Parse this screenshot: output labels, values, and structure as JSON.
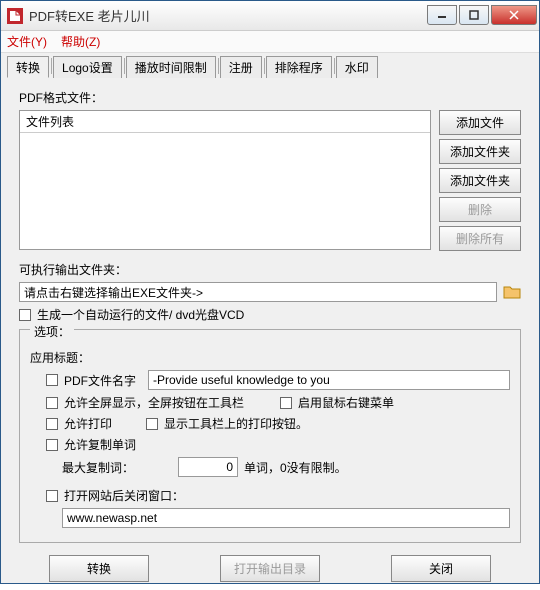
{
  "titlebar": {
    "text": "PDF转EXE   老片儿川"
  },
  "menu": {
    "file": "文件(Y)",
    "help": "帮助(Z)"
  },
  "tabs": [
    "转换",
    "Logo设置",
    "播放时间限制",
    "注册",
    "排除程序",
    "水印"
  ],
  "labels": {
    "pdfFiles": "PDF格式文件：",
    "fileListHeader": "文件列表",
    "outputFolder": "可执行输出文件夹：",
    "outputPlaceholder": "请点击右键选择输出EXE文件夹->",
    "autorun": "生成一个自动运行的文件/ dvd光盘VCD",
    "options": "选项：",
    "appTitle": "应用标题：",
    "pdfFileName": "PDF文件名字",
    "appTitleValue": "-Provide useful knowledge to you",
    "fullscreen": "允许全屏显示，全屏按钮在工具栏",
    "rightClick": "启用鼠标右键菜单",
    "allowPrint": "允许打印",
    "showPrintBtn": "显示工具栏上的打印按钮。",
    "allowCopy": "允许复制单词",
    "maxCopy": "最大复制词：",
    "maxCopyValue": "0",
    "wordsNote": "单词，0没有限制。",
    "closeAfter": "打开网站后关闭窗口：",
    "url": "www.newasp.net"
  },
  "sideButtons": {
    "addFile": "添加文件",
    "addFolder1": "添加文件夹",
    "addFolder2": "添加文件夹",
    "delete": "删除",
    "deleteAll": "删除所有"
  },
  "bottomButtons": {
    "convert": "转换",
    "openOutput": "打开输出目录",
    "close": "关闭"
  }
}
